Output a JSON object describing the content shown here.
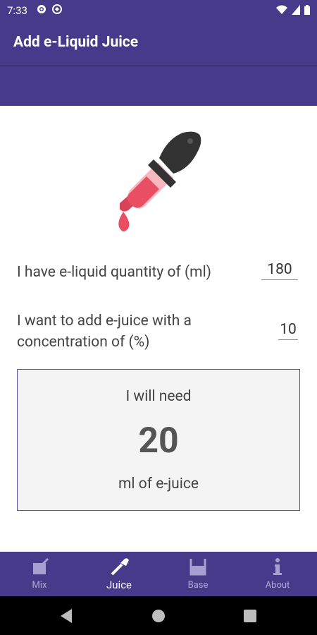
{
  "status": {
    "time": "7:33"
  },
  "appbar": {
    "title": "Add e-Liquid Juice"
  },
  "form": {
    "quantity_label": "I have e-liquid quantity of (ml)",
    "quantity_value": "180",
    "concentration_label_1": "I want to add e-juice with a",
    "concentration_label_2": "concentration of (%)",
    "concentration_value": "10"
  },
  "result": {
    "line1": "I will need",
    "value": "20",
    "line3": "ml of e-juice"
  },
  "nav": [
    {
      "label": "Mix",
      "icon": "mix-icon"
    },
    {
      "label": "Juice",
      "icon": "dropper-icon"
    },
    {
      "label": "Base",
      "icon": "beaker-icon"
    },
    {
      "label": "About",
      "icon": "info-icon"
    }
  ],
  "colors": {
    "primary": "#483a8a",
    "dropper": "#e94e64"
  }
}
